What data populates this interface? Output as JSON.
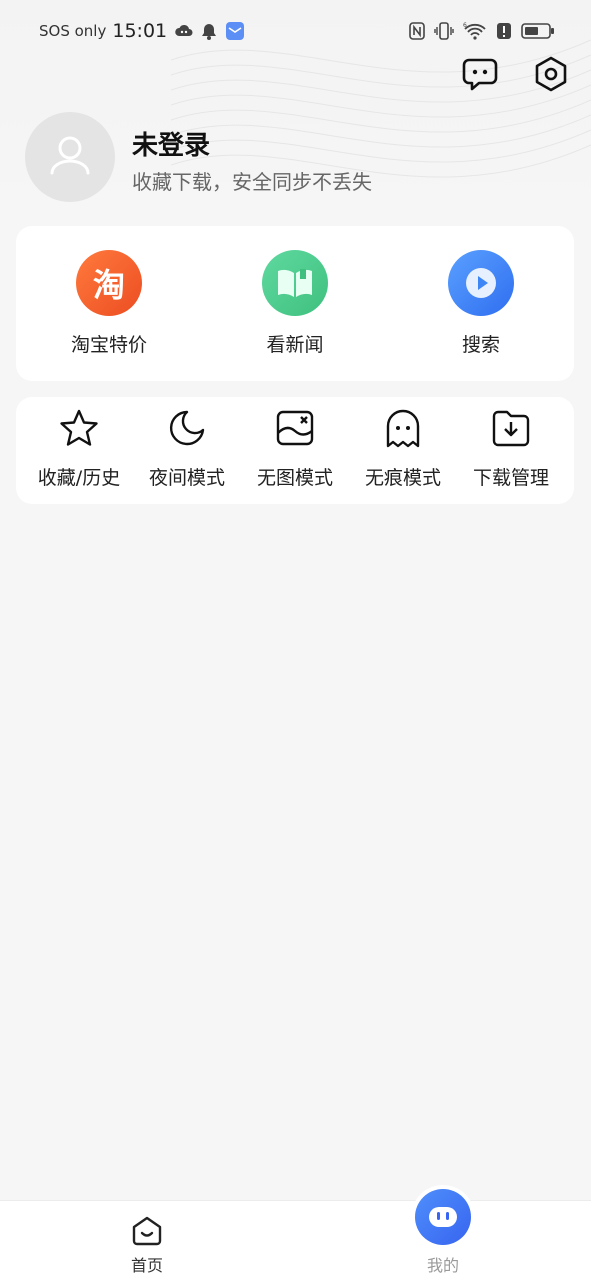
{
  "status_bar": {
    "carrier": "SOS only",
    "time": "15:01",
    "icons": [
      "cloud-game-icon",
      "bell-icon",
      "mail-app-icon",
      "nfc-icon",
      "vibrate-icon",
      "wifi-6-icon",
      "alert-icon",
      "battery-icon"
    ]
  },
  "header": {
    "icons": [
      "chat-icon",
      "settings-icon"
    ]
  },
  "profile": {
    "title": "未登录",
    "subtitle": "收藏下载，安全同步不丢失",
    "avatar_icon": "user-icon"
  },
  "apps": [
    {
      "label": "淘宝特价",
      "icon": "taobao-icon",
      "glyph": "淘",
      "color": "#f05a2b"
    },
    {
      "label": "看新闻",
      "icon": "news-book-icon",
      "color": "#4cd08c"
    },
    {
      "label": "搜索",
      "icon": "play-search-icon",
      "color": "#3d86f5"
    }
  ],
  "tools": [
    {
      "label": "收藏/历史",
      "icon": "star-icon"
    },
    {
      "label": "夜间模式",
      "icon": "moon-icon"
    },
    {
      "label": "无图模式",
      "icon": "no-image-icon"
    },
    {
      "label": "无痕模式",
      "icon": "ghost-icon"
    },
    {
      "label": "下载管理",
      "icon": "download-folder-icon"
    }
  ],
  "bottom_nav": {
    "home_label": "首页",
    "mine_label": "我的",
    "active": "我的",
    "accent_color": "#3f73f3"
  }
}
